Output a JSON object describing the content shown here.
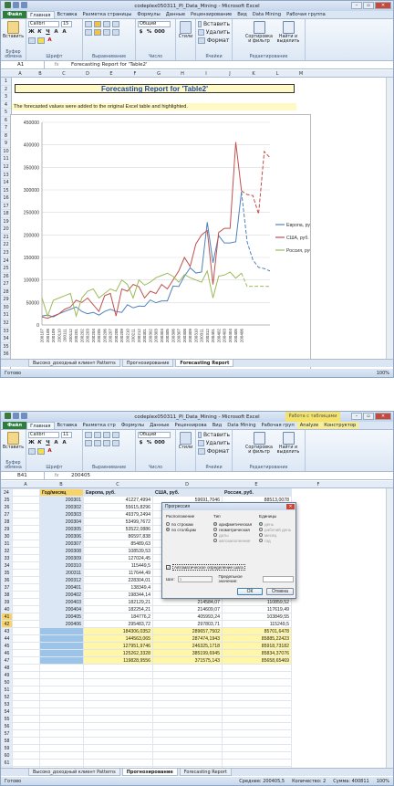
{
  "top": {
    "window_title": "codeplex050311_PI_Data_Mining - Microsoft Excel",
    "tabs": [
      "Файл",
      "Главная",
      "Вставка",
      "Разметка страницы",
      "Формулы",
      "Данные",
      "Рецензирование",
      "Вид",
      "Data Mining",
      "Рабочая группа"
    ],
    "ribbon": {
      "paste": "Вставить",
      "font_name": "Calibri",
      "font_size": "15",
      "number_format": "Общий",
      "styles": "Стили",
      "insert": "Вставить",
      "delete": "Удалить",
      "format": "Формат",
      "sort": "Сортировка и фильтр",
      "find": "Найти и выделить",
      "groups": [
        "Буфер обмена",
        "Шрифт",
        "Выравнивание",
        "Число",
        "Ячейки",
        "Редактирование"
      ]
    },
    "name_box": "A1",
    "formula": "Forecasting Report for 'Table2'",
    "columns": [
      "A",
      "B",
      "C",
      "D",
      "E",
      "F",
      "G",
      "H",
      "I",
      "J",
      "K",
      "L",
      "M"
    ],
    "rows": [
      "1",
      "2",
      "3",
      "4",
      "5",
      "6",
      "7",
      "8",
      "9",
      "10",
      "11",
      "12",
      "13",
      "14",
      "15",
      "16",
      "17",
      "18",
      "19",
      "20",
      "21",
      "22",
      "23",
      "24",
      "25",
      "26",
      "27",
      "28",
      "29",
      "30",
      "31",
      "32",
      "33",
      "34",
      "35",
      "36"
    ],
    "title": "Forecasting Report for 'Table2'",
    "note": "The forecasted values were added to the original Excel table and highlighted.",
    "sheet_tabs": [
      "Высоко_доходный клиент Patterns",
      "Прогнозирование",
      "Forecasting Report"
    ],
    "status": "Готово",
    "zoom": "100%"
  },
  "chart_data": {
    "type": "line",
    "title": "",
    "ylim": [
      0,
      450000
    ],
    "yticks": [
      0,
      50000,
      100000,
      150000,
      200000,
      250000,
      300000,
      350000,
      400000,
      450000
    ],
    "ytick_labels": [
      "0",
      "50000",
      "100000",
      "150000",
      "200000",
      "250000",
      "300000",
      "350000",
      "400000",
      "450000"
    ],
    "x": [
      "200107",
      "200108",
      "200109",
      "200110",
      "200111",
      "200112",
      "200201",
      "200202",
      "200203",
      "200204",
      "200205",
      "200206",
      "200207",
      "200208",
      "200209",
      "200210",
      "200211",
      "200212",
      "200301",
      "200302",
      "200303",
      "200304",
      "200305",
      "200306",
      "200307",
      "200308",
      "200309",
      "200310",
      "200311",
      "200312",
      "200401",
      "200402",
      "200403",
      "200404",
      "200405",
      "200406",
      "200407",
      "200408",
      "200409",
      "200410",
      "200411"
    ],
    "x_labels": [
      "200107",
      "200108",
      "200109",
      "200110",
      "200111",
      "200112",
      "200201",
      "200202",
      "200203",
      "200204",
      "200205",
      "200206",
      "200207",
      "200208",
      "200209",
      "200210",
      "200211",
      "200212",
      "200301",
      "200302",
      "200303",
      "200304",
      "200305",
      "200306",
      "200307",
      "200308",
      "200309",
      "200310",
      "200311",
      "200312",
      "200401",
      "200402",
      "200403",
      "200404",
      "200405",
      "200406"
    ],
    "legend_position": "right",
    "series": [
      {
        "name": "Европа, руб.",
        "color": "#4f81bd",
        "values": [
          20000,
          22000,
          18000,
          25000,
          30000,
          35000,
          40000,
          30000,
          25000,
          28000,
          22000,
          30000,
          35000,
          30000,
          28000,
          45000,
          38000,
          42000,
          41227,
          55615,
          49379,
          53499,
          53522,
          86597,
          85489,
          108539,
          127024,
          115449,
          117644,
          228304,
          138349,
          198344,
          182129,
          182254,
          184776,
          295483,
          184306,
          144563,
          127951,
          125262,
          119828
        ],
        "forecast_from": 36
      },
      {
        "name": "США, руб.",
        "color": "#c0504d",
        "values": [
          18000,
          15000,
          20000,
          25000,
          35000,
          40000,
          55000,
          50000,
          60000,
          45000,
          30000,
          65000,
          70000,
          20000,
          80000,
          75000,
          90000,
          85000,
          60000,
          75000,
          70000,
          90000,
          80000,
          100000,
          120000,
          150000,
          130000,
          180000,
          200000,
          210000,
          90000,
          205329,
          214584,
          214609,
          405993,
          297803,
          289657,
          287474,
          246325,
          385199,
          371575
        ],
        "forecast_from": 36
      },
      {
        "name": "Россия, руб.",
        "color": "#9bbb59",
        "values": [
          60000,
          20000,
          55000,
          60000,
          65000,
          70000,
          20000,
          60000,
          75000,
          80000,
          60000,
          70000,
          80000,
          75000,
          100000,
          90000,
          60000,
          100000,
          88513,
          95000,
          105000,
          110000,
          115000,
          108000,
          95000,
          112000,
          105000,
          100000,
          95000,
          120000,
          60000,
          108539,
          110859,
          117619,
          103849,
          115249,
          85701,
          85885,
          85918,
          85834,
          85658
        ],
        "forecast_from": 36
      }
    ]
  },
  "bottom": {
    "window_title": "codeplex050311_PI_Data_Mining - Microsoft Excel",
    "context_label": "Работа с таблицами",
    "tabs": [
      "Файл",
      "Главная",
      "Вставка",
      "Разметка стр",
      "Формулы",
      "Данные",
      "Рецензирова",
      "Вид",
      "Data Mining",
      "Рабочая груп",
      "Analyze",
      "Конструктор"
    ],
    "ribbon": {
      "paste": "Вставить",
      "font_name": "Calibri",
      "font_size": "11",
      "number_format": "Общий",
      "styles": "Стили",
      "insert": "Вставить",
      "delete": "Удалить",
      "format": "Формат",
      "sort": "Сортировка и фильтр",
      "find": "Найти и выделить",
      "groups": [
        "Буфер обмена",
        "Шрифт",
        "Выравнивание",
        "Число",
        "Ячейки",
        "Редактирование"
      ]
    },
    "name_box": "B41",
    "formula": "200405",
    "columns": [
      "A",
      "B",
      "C",
      "D",
      "E",
      "F"
    ],
    "headers": [
      "Год/месяц",
      "Европа, руб.",
      "США, руб.",
      "Россия, руб."
    ],
    "rows": [
      [
        "25",
        "200301",
        "41227,4994",
        "59691,7046",
        "88513,0078"
      ],
      [
        "26",
        "200302",
        "55615,8296",
        "",
        ""
      ],
      [
        "27",
        "200303",
        "49379,2494",
        "",
        ""
      ],
      [
        "28",
        "200304",
        "53499,7672",
        "",
        ""
      ],
      [
        "29",
        "200305",
        "53522,0886",
        "",
        ""
      ],
      [
        "30",
        "200306",
        "86597,838",
        "",
        ""
      ],
      [
        "31",
        "200307",
        "85489,63",
        "",
        ""
      ],
      [
        "32",
        "200308",
        "108539,53",
        "",
        ""
      ],
      [
        "33",
        "200309",
        "127024,45",
        "",
        ""
      ],
      [
        "34",
        "200310",
        "115449,5",
        "",
        ""
      ],
      [
        "35",
        "200311",
        "117644,49",
        "",
        ""
      ],
      [
        "36",
        "200312",
        "228304,01",
        "",
        ""
      ],
      [
        "37",
        "200401",
        "138349,4",
        "",
        ""
      ],
      [
        "38",
        "200402",
        "198344,14",
        "205329,11",
        "108539,53"
      ],
      [
        "39",
        "200403",
        "182129,21",
        "214584,07",
        "110859,52"
      ],
      [
        "40",
        "200404",
        "182254,21",
        "214609,07",
        "117619,49"
      ],
      [
        "41",
        "200405",
        "184776,2",
        "405993,24",
        "103849,55"
      ],
      [
        "42",
        "200406",
        "295483,72",
        "297803,71",
        "115249,5"
      ],
      [
        "43",
        "",
        "184306,0352",
        "289657,7502",
        "85701,6478"
      ],
      [
        "44",
        "",
        "144563,065",
        "287474,1943",
        "85885,22423"
      ],
      [
        "45",
        "",
        "127951,9746",
        "246325,1718",
        "85918,73182"
      ],
      [
        "46",
        "",
        "125262,3328",
        "385199,6945",
        "85834,37076"
      ],
      [
        "47",
        "",
        "119828,9556",
        "371575,143",
        "85658,65469"
      ],
      [
        "48",
        "",
        "",
        "",
        ""
      ],
      [
        "49",
        "",
        "",
        "",
        ""
      ],
      [
        "50",
        "",
        "",
        "",
        ""
      ],
      [
        "51",
        "",
        "",
        "",
        ""
      ],
      [
        "52",
        "",
        "",
        "",
        ""
      ],
      [
        "53",
        "",
        "",
        "",
        ""
      ],
      [
        "54",
        "",
        "",
        "",
        ""
      ],
      [
        "55",
        "",
        "",
        "",
        ""
      ],
      [
        "56",
        "",
        "",
        "",
        ""
      ],
      [
        "57",
        "",
        "",
        "",
        ""
      ],
      [
        "58",
        "",
        "",
        "",
        ""
      ],
      [
        "59",
        "",
        "",
        "",
        ""
      ],
      [
        "60",
        "",
        "",
        "",
        ""
      ],
      [
        "61",
        "",
        "",
        "",
        ""
      ],
      [
        "62",
        "",
        "",
        "",
        ""
      ],
      [
        "63",
        "",
        "",
        "",
        ""
      ],
      [
        "64",
        "",
        "",
        "",
        ""
      ],
      [
        "65",
        "",
        "",
        "",
        ""
      ]
    ],
    "dialog": {
      "title": "Прогрессия",
      "layout_label": "Расположение",
      "layout_rows": "по строкам",
      "layout_cols": "по столбцам",
      "type_label": "Тип",
      "type_arith": "арифметическая",
      "type_geom": "геометрическая",
      "type_dates": "даты",
      "type_auto": "автозаполнение",
      "units_label": "Единицы",
      "unit_day": "день",
      "unit_workday": "рабочий день",
      "unit_month": "месяц",
      "unit_year": "год",
      "auto_step": "Автоматическое определение шага",
      "step_label": "Шаг:",
      "step_value": "1",
      "limit_label": "Предельное значение:",
      "ok": "ОК",
      "cancel": "Отмена"
    },
    "sheet_tabs": [
      "Высоко_доходный клиент Patterns",
      "Прогнозирование",
      "Forecasting Report"
    ],
    "status": "Готово",
    "status_avg": "Среднее: 200405,5",
    "status_count": "Количество: 2",
    "status_sum": "Сумма: 400811",
    "zoom": "100%"
  }
}
